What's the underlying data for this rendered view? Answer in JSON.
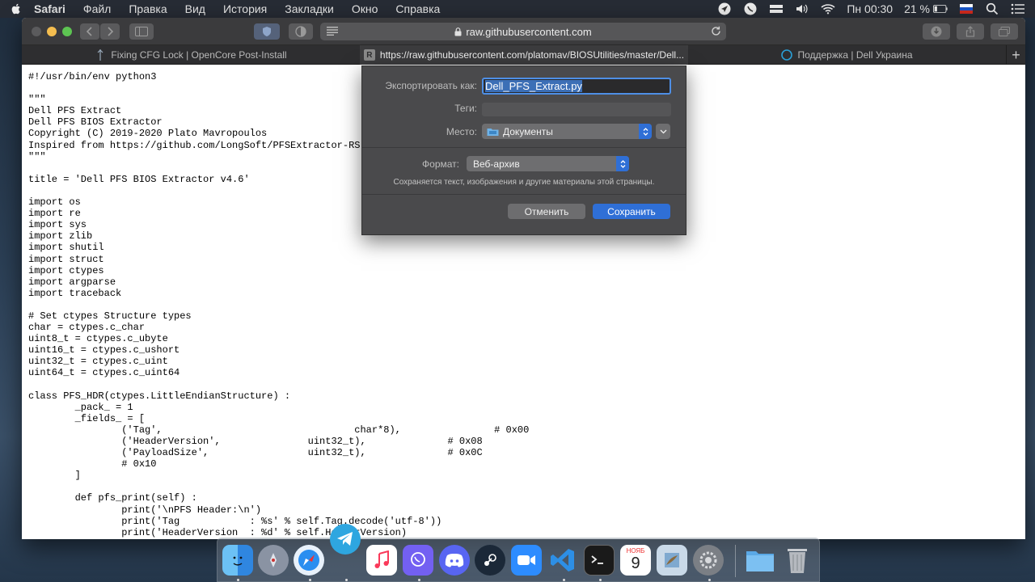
{
  "menubar": {
    "app_name": "Safari",
    "items": [
      "Файл",
      "Правка",
      "Вид",
      "История",
      "Закладки",
      "Окно",
      "Справка"
    ],
    "clock": "Пн 00:30",
    "battery": "21 %"
  },
  "toolbar": {
    "address": "raw.githubusercontent.com"
  },
  "tabs": [
    {
      "label": "Fixing CFG Lock | OpenCore Post-Install",
      "favicon": "opencore-icon"
    },
    {
      "label": "https://raw.githubusercontent.com/platomav/BIOSUtilities/master/Dell...",
      "favicon": "R"
    },
    {
      "label": "Поддержка | Dell Украина",
      "favicon": "dell-icon"
    }
  ],
  "code_lines": [
    "#!/usr/bin/env python3",
    "",
    "\"\"\"",
    "Dell PFS Extract",
    "Dell PFS BIOS Extractor",
    "Copyright (C) 2019-2020 Plato Mavropoulos",
    "Inspired from https://github.com/LongSoft/PFSExtractor-RS",
    "\"\"\"",
    "",
    "title = 'Dell PFS BIOS Extractor v4.6'",
    "",
    "import os",
    "import re",
    "import sys",
    "import zlib",
    "import shutil",
    "import struct",
    "import ctypes",
    "import argparse",
    "import traceback",
    "",
    "# Set ctypes Structure types",
    "char = ctypes.c_char",
    "uint8_t = ctypes.c_ubyte",
    "uint16_t = ctypes.c_ushort",
    "uint32_t = ctypes.c_uint",
    "uint64_t = ctypes.c_uint64",
    "",
    "class PFS_HDR(ctypes.LittleEndianStructure) :",
    "        _pack_ = 1",
    "        _fields_ = [",
    "                ('Tag',                                 char*8),                # 0x00",
    "                ('HeaderVersion',               uint32_t),              # 0x08",
    "                ('PayloadSize',                 uint32_t),              # 0x0C",
    "                # 0x10",
    "        ]",
    "",
    "        def pfs_print(self) :",
    "                print('\\nPFS Header:\\n')",
    "                print('Tag            : %s' % self.Tag.decode('utf-8'))",
    "                print('HeaderVersion  : %d' % self.HeaderVersion)"
  ],
  "save_dialog": {
    "export_label": "Экспортировать как:",
    "export_value": "Dell_PFS_Extract.py",
    "tags_label": "Теги:",
    "location_label": "Место:",
    "location_value": "Документы",
    "format_label": "Формат:",
    "format_value": "Веб-архив",
    "format_desc": "Сохраняется текст, изображения и другие материалы этой страницы.",
    "cancel_label": "Отменить",
    "save_label": "Сохранить",
    "colors": {
      "primary_button": "#2f6fd6",
      "focus_ring": "#4e8fe6"
    }
  },
  "dock": {
    "items": [
      "finder-icon",
      "launchpad-icon",
      "safari-icon",
      "telegram-icon",
      "music-icon",
      "viber-icon",
      "discord-icon",
      "steam-icon",
      "zoom-icon",
      "vscode-icon",
      "terminal-icon",
      "calendar-icon",
      "preview-icon",
      "system-preferences-icon",
      "downloads-folder-icon",
      "trash-icon"
    ],
    "calendar_month": "НОЯБ",
    "calendar_day": "9"
  }
}
